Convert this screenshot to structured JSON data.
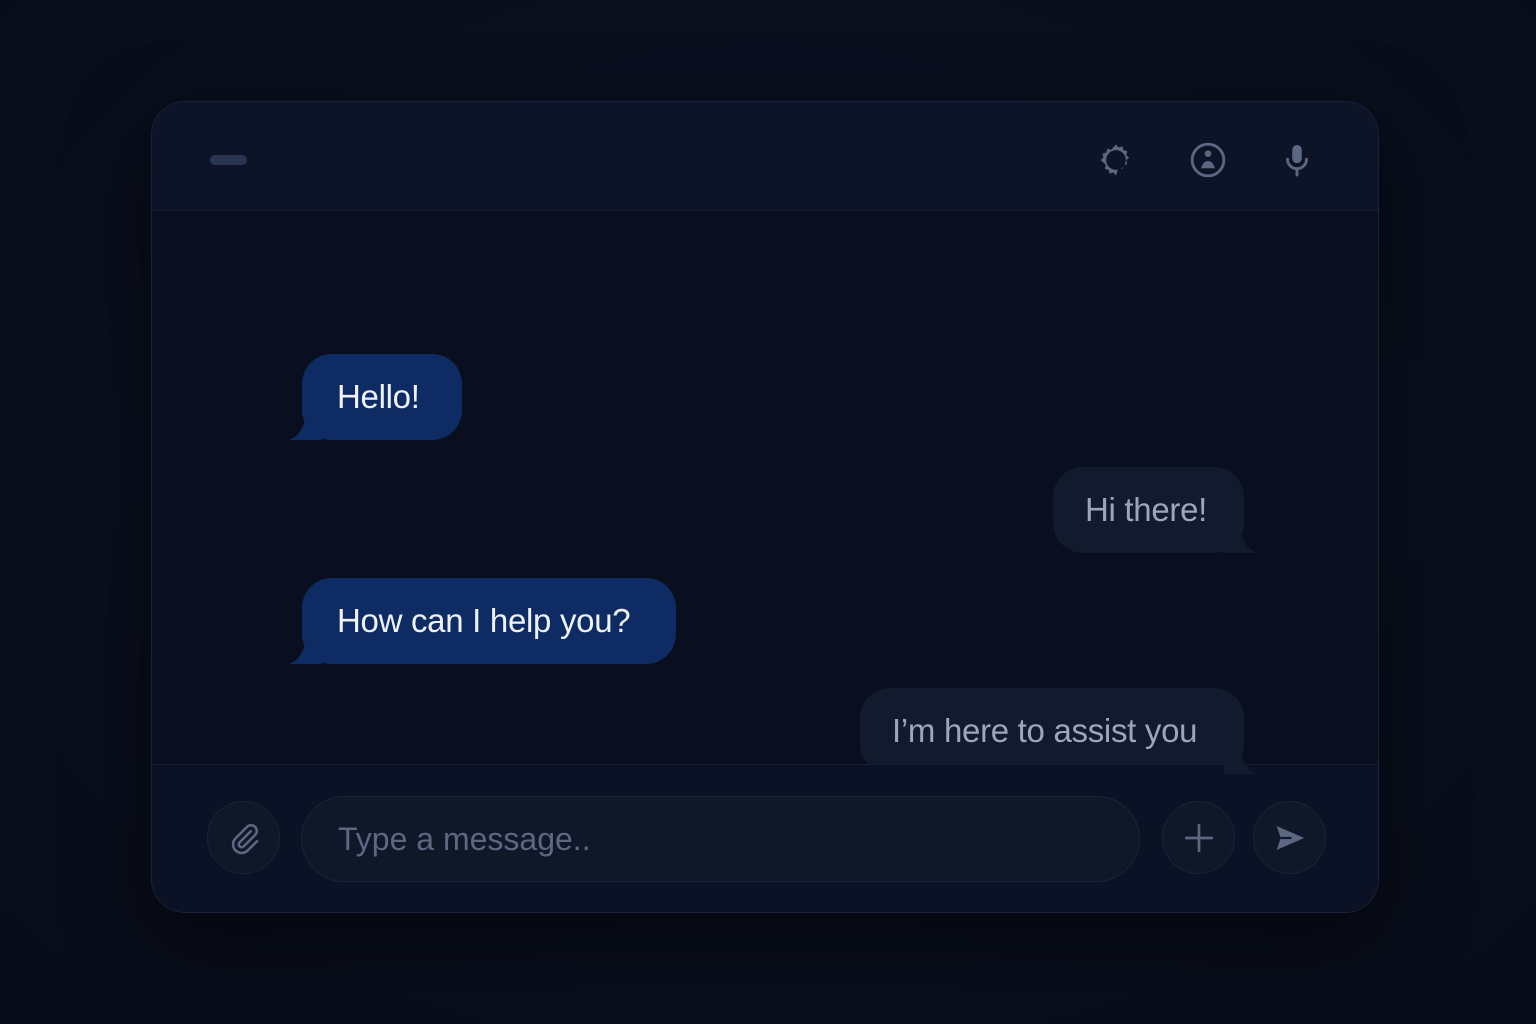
{
  "header": {
    "icons": [
      "minimize-icon",
      "gear-icon",
      "user-info-icon",
      "microphone-icon"
    ]
  },
  "messages": [
    {
      "sender": "incoming",
      "text": "Hello!"
    },
    {
      "sender": "outgoing",
      "text": "Hi there!"
    },
    {
      "sender": "incoming",
      "text": "How can I help you?"
    },
    {
      "sender": "outgoing",
      "text": "I’m here to assist you"
    }
  ],
  "composer": {
    "placeholder": "Type a message..",
    "value": "",
    "icons": [
      "paperclip-icon",
      "plus-icon",
      "send-icon"
    ]
  },
  "colors": {
    "background": "#0a0f1e",
    "window": "#0b1122",
    "incoming_bubble": "#0e2c63",
    "outgoing_bubble": "#121a2e",
    "icon": "#5c6882"
  }
}
